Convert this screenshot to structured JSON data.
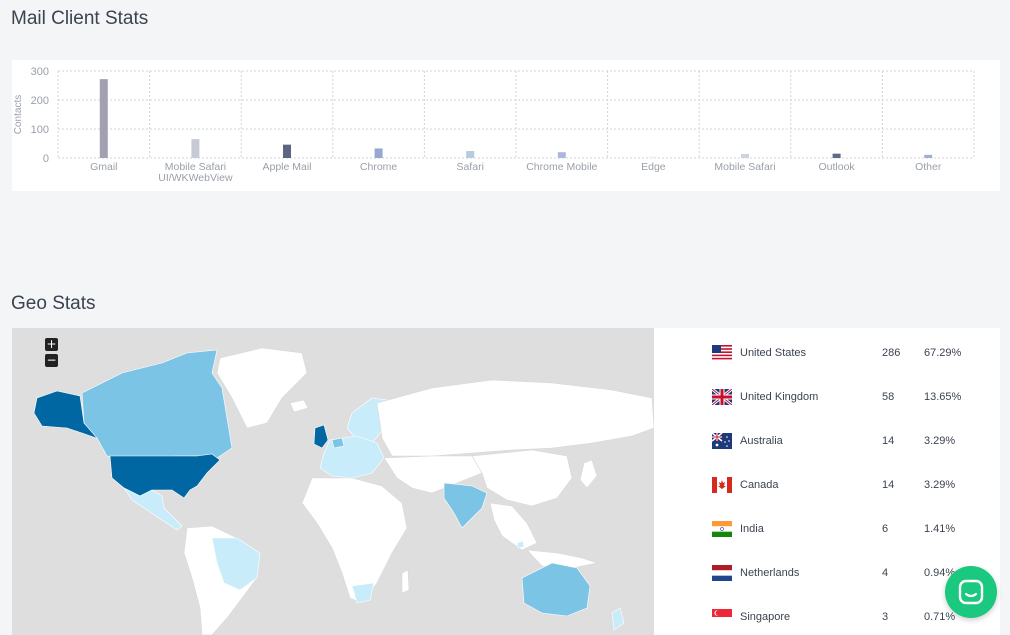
{
  "mail_client_stats": {
    "title": "Mail Client Stats"
  },
  "geo_stats": {
    "title": "Geo Stats",
    "zoom_in_label": "+",
    "zoom_out_label": "−",
    "countries": [
      {
        "name": "United States",
        "count": "286",
        "percent": "67.29%",
        "flag_icon": "us-flag-icon"
      },
      {
        "name": "United Kingdom",
        "count": "58",
        "percent": "13.65%",
        "flag_icon": "uk-flag-icon"
      },
      {
        "name": "Australia",
        "count": "14",
        "percent": "3.29%",
        "flag_icon": "australia-flag-icon"
      },
      {
        "name": "Canada",
        "count": "14",
        "percent": "3.29%",
        "flag_icon": "canada-flag-icon"
      },
      {
        "name": "India",
        "count": "6",
        "percent": "1.41%",
        "flag_icon": "india-flag-icon"
      },
      {
        "name": "Netherlands",
        "count": "4",
        "percent": "0.94%",
        "flag_icon": "netherlands-flag-icon"
      },
      {
        "name": "Singapore",
        "count": "3",
        "percent": "0.71%",
        "flag_icon": "singapore-flag-icon"
      }
    ]
  },
  "chat_button": {
    "icon": "chat-icon",
    "color": "#1ac87f"
  },
  "chart_data": {
    "type": "bar",
    "title": "",
    "xlabel": "",
    "ylabel": "Contacts",
    "ylim": [
      0,
      300
    ],
    "yticks": [
      0,
      100,
      200,
      300
    ],
    "grid": true,
    "categories": [
      "Gmail",
      "Mobile Safari\nUI/WKWebView",
      "Apple Mail",
      "Chrome",
      "Safari",
      "Chrome Mobile",
      "Edge",
      "Mobile Safari",
      "Outlook",
      "Other"
    ],
    "values": [
      272,
      65,
      46,
      33,
      24,
      20,
      5,
      14,
      15,
      11
    ],
    "colors": [
      "#a3a1b1",
      "#c5cad5",
      "#5c6680",
      "#97a8cf",
      "#b6cae1",
      "#a8b9dd",
      "#eef1f4",
      "#ced4df",
      "#5d6a88",
      "#a3b1d0"
    ]
  }
}
